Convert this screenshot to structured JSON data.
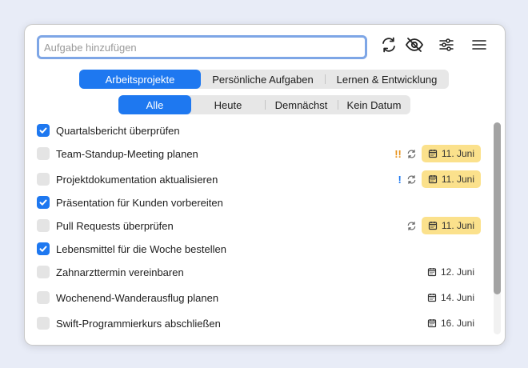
{
  "search": {
    "placeholder": "Aufgabe hinzufügen"
  },
  "toolbar": {
    "icons": [
      "sync-icon",
      "hide-icon",
      "sliders-icon",
      "menu-icon"
    ]
  },
  "projects": {
    "items": [
      "Arbeitsprojekte",
      "Persönliche Aufgaben",
      "Lernen & Entwicklung"
    ],
    "active": "Arbeitsprojekte"
  },
  "filters": {
    "items": [
      "Alle",
      "Heute",
      "Demnächst",
      "Kein Datum"
    ],
    "active": "Alle"
  },
  "tasks": [
    {
      "title": "Quartalsbericht überprüfen",
      "done": true
    },
    {
      "title": "Team-Standup-Meeting planen",
      "done": false,
      "priority": "!!",
      "recurring": true,
      "date": "11. Juni",
      "date_highlight": true
    },
    {
      "title": "Projektdokumentation aktualisieren",
      "done": false,
      "priority": "!",
      "recurring": true,
      "date": "11. Juni",
      "date_highlight": true
    },
    {
      "title": "Präsentation für Kunden vorbereiten",
      "done": true
    },
    {
      "title": "Pull Requests überprüfen",
      "done": false,
      "recurring": true,
      "date": "11. Juni",
      "date_highlight": true
    },
    {
      "title": "Lebensmittel für die Woche bestellen",
      "done": true
    },
    {
      "title": "Zahnarzttermin vereinbaren",
      "done": false,
      "date": "12. Juni"
    },
    {
      "title": "Wochenend-Wanderausflug planen",
      "done": false,
      "date": "14. Juni"
    },
    {
      "title": "Swift-Programmierkurs abschließen",
      "done": false,
      "date": "16. Juni"
    }
  ],
  "colors": {
    "accent": "#1e78f0",
    "priority_high": "#e8921a",
    "priority_medium": "#1e78f0",
    "date_highlight": "#fbe18c"
  }
}
